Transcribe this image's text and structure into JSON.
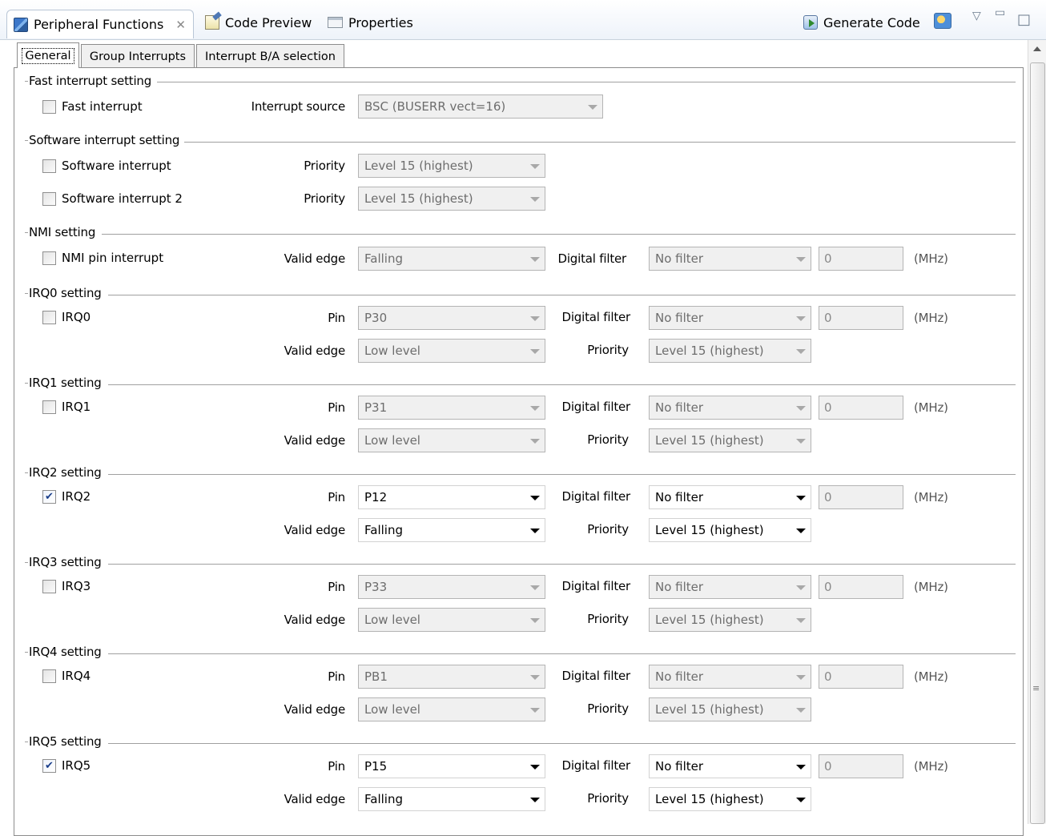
{
  "view_tabs": {
    "peripheral": "Peripheral Functions",
    "code_preview": "Code Preview",
    "properties": "Properties",
    "generate_code": "Generate Code"
  },
  "inner_tabs": [
    "General",
    "Group Interrupts",
    "Interrupt B/A selection"
  ],
  "fast": {
    "title": "Fast interrupt setting",
    "checkbox": "Fast interrupt",
    "source_label": "Interrupt source",
    "source_value": "BSC (BUSERR vect=16)"
  },
  "software": {
    "title": "Software interrupt setting",
    "cb1": "Software interrupt",
    "cb2": "Software interrupt 2",
    "priority_label": "Priority",
    "p1": "Level 15 (highest)",
    "p2": "Level 15 (highest)"
  },
  "nmi": {
    "title": "NMI setting",
    "checkbox": "NMI pin interrupt",
    "edge_label": "Valid edge",
    "edge_value": "Falling",
    "filter_label": "Digital filter",
    "filter_value": "No filter",
    "freq": "0",
    "unit": "(MHz)"
  },
  "labels": {
    "pin": "Pin",
    "valid_edge": "Valid edge",
    "digital_filter": "Digital filter",
    "priority": "Priority",
    "unit": "(MHz)"
  },
  "irq": [
    {
      "title": "IRQ0 setting",
      "name": "IRQ0",
      "checked": false,
      "pin": "P30",
      "edge": "Low level",
      "filter": "No filter",
      "freq": "0",
      "priority": "Level 15 (highest)"
    },
    {
      "title": "IRQ1 setting",
      "name": "IRQ1",
      "checked": false,
      "pin": "P31",
      "edge": "Low level",
      "filter": "No filter",
      "freq": "0",
      "priority": "Level 15 (highest)"
    },
    {
      "title": "IRQ2 setting",
      "name": "IRQ2",
      "checked": true,
      "pin": "P12",
      "edge": "Falling",
      "filter": "No filter",
      "freq": "0",
      "priority": "Level 15 (highest)"
    },
    {
      "title": "IRQ3 setting",
      "name": "IRQ3",
      "checked": false,
      "pin": "P33",
      "edge": "Low level",
      "filter": "No filter",
      "freq": "0",
      "priority": "Level 15 (highest)"
    },
    {
      "title": "IRQ4 setting",
      "name": "IRQ4",
      "checked": false,
      "pin": "PB1",
      "edge": "Low level",
      "filter": "No filter",
      "freq": "0",
      "priority": "Level 15 (highest)"
    },
    {
      "title": "IRQ5 setting",
      "name": "IRQ5",
      "checked": true,
      "pin": "P15",
      "edge": "Falling",
      "filter": "No filter",
      "freq": "0",
      "priority": "Level 15 (highest)"
    }
  ]
}
